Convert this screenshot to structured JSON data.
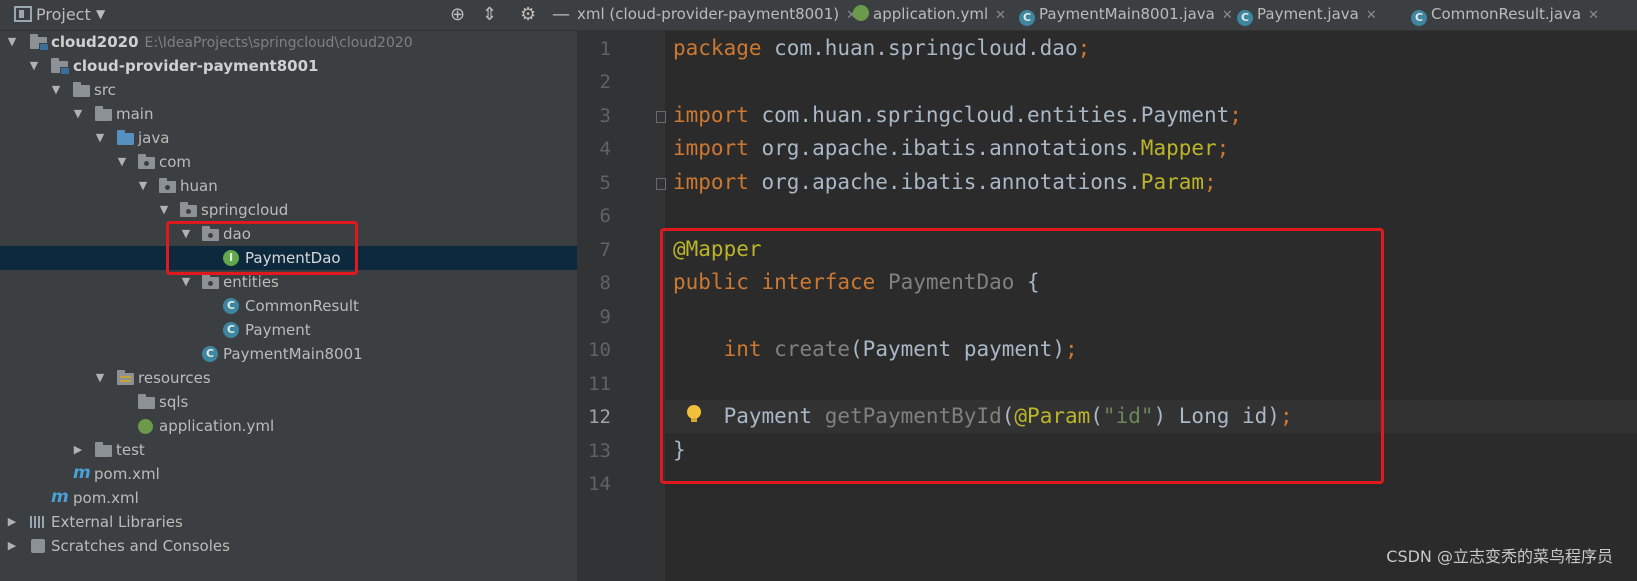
{
  "project_panel": {
    "title": "Project",
    "toolbar_icons": [
      "locate-icon",
      "collapse-icon",
      "gear-icon",
      "minimize-icon"
    ],
    "tree": [
      {
        "label": "cloud2020",
        "path": "E:\\IdeaProjects\\springcloud\\cloud2020"
      },
      {
        "label": "cloud-provider-payment8001"
      },
      {
        "label": "src"
      },
      {
        "label": "main"
      },
      {
        "label": "java"
      },
      {
        "label": "com"
      },
      {
        "label": "huan"
      },
      {
        "label": "springcloud"
      },
      {
        "label": "dao"
      },
      {
        "label": "PaymentDao"
      },
      {
        "label": "entities"
      },
      {
        "label": "CommonResult"
      },
      {
        "label": "Payment"
      },
      {
        "label": "PaymentMain8001"
      },
      {
        "label": "resources"
      },
      {
        "label": "sqls"
      },
      {
        "label": "application.yml"
      },
      {
        "label": "test"
      },
      {
        "label": "pom.xml"
      },
      {
        "label": "pom.xml"
      },
      {
        "label": "External Libraries"
      },
      {
        "label": "Scratches and Consoles"
      }
    ]
  },
  "tabs": [
    {
      "label": "xml (cloud-provider-payment8001)",
      "icon": null
    },
    {
      "label": "application.yml",
      "icon": "yml"
    },
    {
      "label": "PaymentMain8001.java",
      "icon": "class"
    },
    {
      "label": "Payment.java",
      "icon": "class"
    },
    {
      "label": "CommonResult.java",
      "icon": "class"
    }
  ],
  "editor": {
    "line_numbers": [
      "1",
      "2",
      "3",
      "4",
      "5",
      "6",
      "7",
      "8",
      "9",
      "10",
      "11",
      "12",
      "13",
      "14"
    ],
    "current_line": "12",
    "code": {
      "l1_kw": "package",
      "l1_rest": " com.huan.springcloud.dao",
      "l1_semi": ";",
      "l3_kw": "import",
      "l3_rest": " com.huan.springcloud.entities.Payment",
      "l3_semi": ";",
      "l4_kw": "import",
      "l4_rest": " org.apache.ibatis.annotations.",
      "l4_an": "Mapper",
      "l4_semi": ";",
      "l5_kw": "import",
      "l5_rest": " org.apache.ibatis.annotations.",
      "l5_an": "Param",
      "l5_semi": ";",
      "l7_an": "@Mapper",
      "l8_kw": "public interface ",
      "l8_name": "PaymentDao",
      "l8_rest": " {",
      "l10_indent": "    ",
      "l10_kw": "int",
      "l10_sp": " ",
      "l10_fn": "create",
      "l10_rest": "(Payment payment)",
      "l10_semi": ";",
      "l12_indent": "    ",
      "l12_type": "Payment ",
      "l12_fn": "getPaymentById",
      "l12_p1": "(",
      "l12_an": "@Param",
      "l12_p2": "(",
      "l12_str": "\"id\"",
      "l12_p3": ") Long id)",
      "l12_semi": ";",
      "l13": "}"
    }
  },
  "watermark": "CSDN @立志变秃的菜鸟程序员",
  "colors": {
    "highlight_box": "#e0191f",
    "keyword": "#cc7832",
    "annotation": "#bbb529",
    "string": "#6a8759"
  }
}
